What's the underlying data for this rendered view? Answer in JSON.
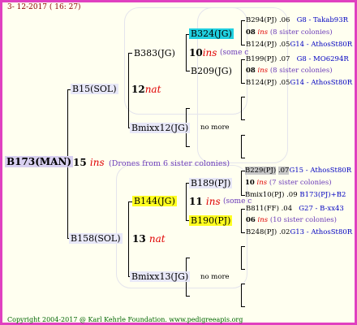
{
  "date": "3- 12-2017 ( 16: 27)",
  "footer": "Copyright 2004-2017 @ Karl Kehrle Foundation.   www.pedigreeapis.org",
  "root": {
    "name": "B173(MAN)",
    "num": "15",
    "suffix": "ins",
    "note": "(Drones from 6 sister colonies)"
  },
  "upper": {
    "name": "B15(SOL)",
    "num": "12",
    "suffix": "nat",
    "a": {
      "name": "B383(JG)",
      "num": "10",
      "suffix": "ins",
      "note": "(some c",
      "b324": {
        "name": "B324(JG)",
        "l1": {
          "id": "B294(PJ)",
          "num": ".06",
          "tail": "G8 - Takab93R"
        },
        "l2": {
          "num": "08",
          "suffix": "ins",
          "note": "(8 sister colonies)"
        },
        "l3": {
          "id": "B124(PJ)",
          "num": ".05",
          "tail": "G14 - AthosSt80R"
        }
      },
      "b209": {
        "name": "B209(JG)",
        "l1": {
          "id": "B199(PJ)",
          "num": ".07",
          "tail": "G8 - MO6294R"
        },
        "l2": {
          "num": "08",
          "suffix": "ins",
          "note": "(8 sister colonies)"
        },
        "l3": {
          "id": "B124(PJ)",
          "num": ".05",
          "tail": "G14 - AthosSt80R"
        }
      }
    },
    "b": {
      "name": "Bmixx12(JG)",
      "more": "no more"
    }
  },
  "lower": {
    "name": "B158(SOL)",
    "num": "13",
    "suffix": "nat",
    "a": {
      "name": "B144(JG)",
      "num": "11",
      "suffix": "ins",
      "note": "(some c",
      "b189": {
        "name": "B189(PJ)",
        "l1": {
          "id": "B229(PJ)",
          "num": ".07",
          "tail": "G15 - AthosSt80R"
        },
        "l2": {
          "num": "10",
          "suffix": "ins",
          "note": "(7 sister colonies)"
        },
        "l3": {
          "id": "Bmix10(PJ)",
          "num": ".09",
          "tail": "B173(PJ)+B2"
        }
      },
      "b190": {
        "name": "B190(PJ)",
        "l1": {
          "id": "B811(FF)",
          "num": ".04",
          "tail": "G27 - B-xx43"
        },
        "l2": {
          "num": "06",
          "suffix": "ins",
          "note": "(10 sister colonies)"
        },
        "l3": {
          "id": "B248(PJ)",
          "num": ".02",
          "tail": "G13 - AthosSt80R"
        }
      }
    },
    "b": {
      "name": "Bmixx13(JG)",
      "more": "no more"
    }
  }
}
